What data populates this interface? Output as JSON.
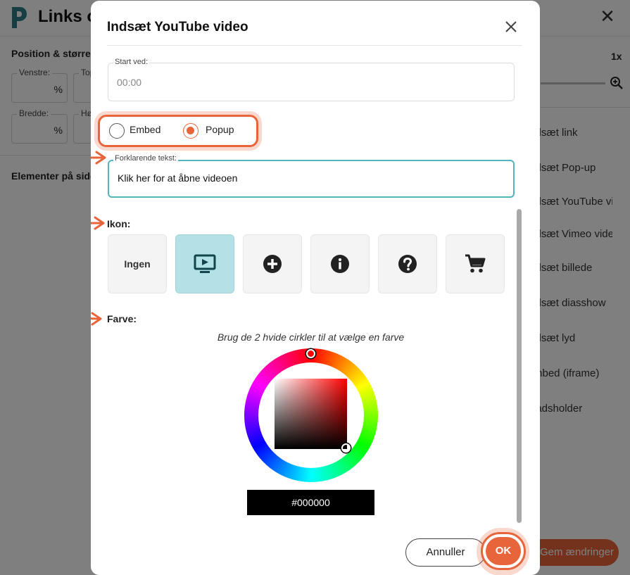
{
  "app": {
    "title": "Links og",
    "position_section_title": "Position & størrelse",
    "left_label": "Venstre:",
    "top_label": "Top:",
    "width_label": "Bredde:",
    "height_label": "Højde:",
    "percent_unit": "%",
    "elements_title": "Elementer på siden",
    "zoom_level": "1x",
    "right_items": [
      "Indsæt link",
      "Indsæt Pop-up",
      "Indsæt YouTube video",
      "Indsæt Vimeo video",
      "Indsæt billede",
      "Indsæt diasshow",
      "Indsæt lyd",
      "Embed (iframe)",
      "Pladsholder"
    ],
    "save_label": "Gem ændringer"
  },
  "dialog": {
    "title": "Indsæt YouTube video",
    "start_field": {
      "label": "Start ved:",
      "placeholder": "00:00"
    },
    "mode_options": [
      {
        "label": "Embed",
        "selected": false
      },
      {
        "label": "Popup",
        "selected": true
      }
    ],
    "text_field": {
      "label": "Forklarende tekst:",
      "value": "Klik her for at åbne videoen"
    },
    "icon_section_title": "Ikon:",
    "icon_options": [
      {
        "label": "Ingen",
        "icon": "none",
        "selected": false
      },
      {
        "icon": "tv-play-icon",
        "selected": true
      },
      {
        "icon": "plus-circle-icon",
        "selected": false
      },
      {
        "icon": "info-circle-icon",
        "selected": false
      },
      {
        "icon": "question-circle-icon",
        "selected": false
      },
      {
        "icon": "shopping-cart-icon",
        "selected": false
      }
    ],
    "color_section_title": "Farve:",
    "color_hint": "Brug de 2 hvide cirkler til at vælge en farve",
    "color_value": "#000000",
    "cancel_label": "Annuller",
    "ok_label": "OK"
  },
  "colors": {
    "accent": "#e8643a",
    "selected_tile": "#b4e1e6",
    "focus_border": "#4fb6bf",
    "logo": "#2a7f87"
  }
}
